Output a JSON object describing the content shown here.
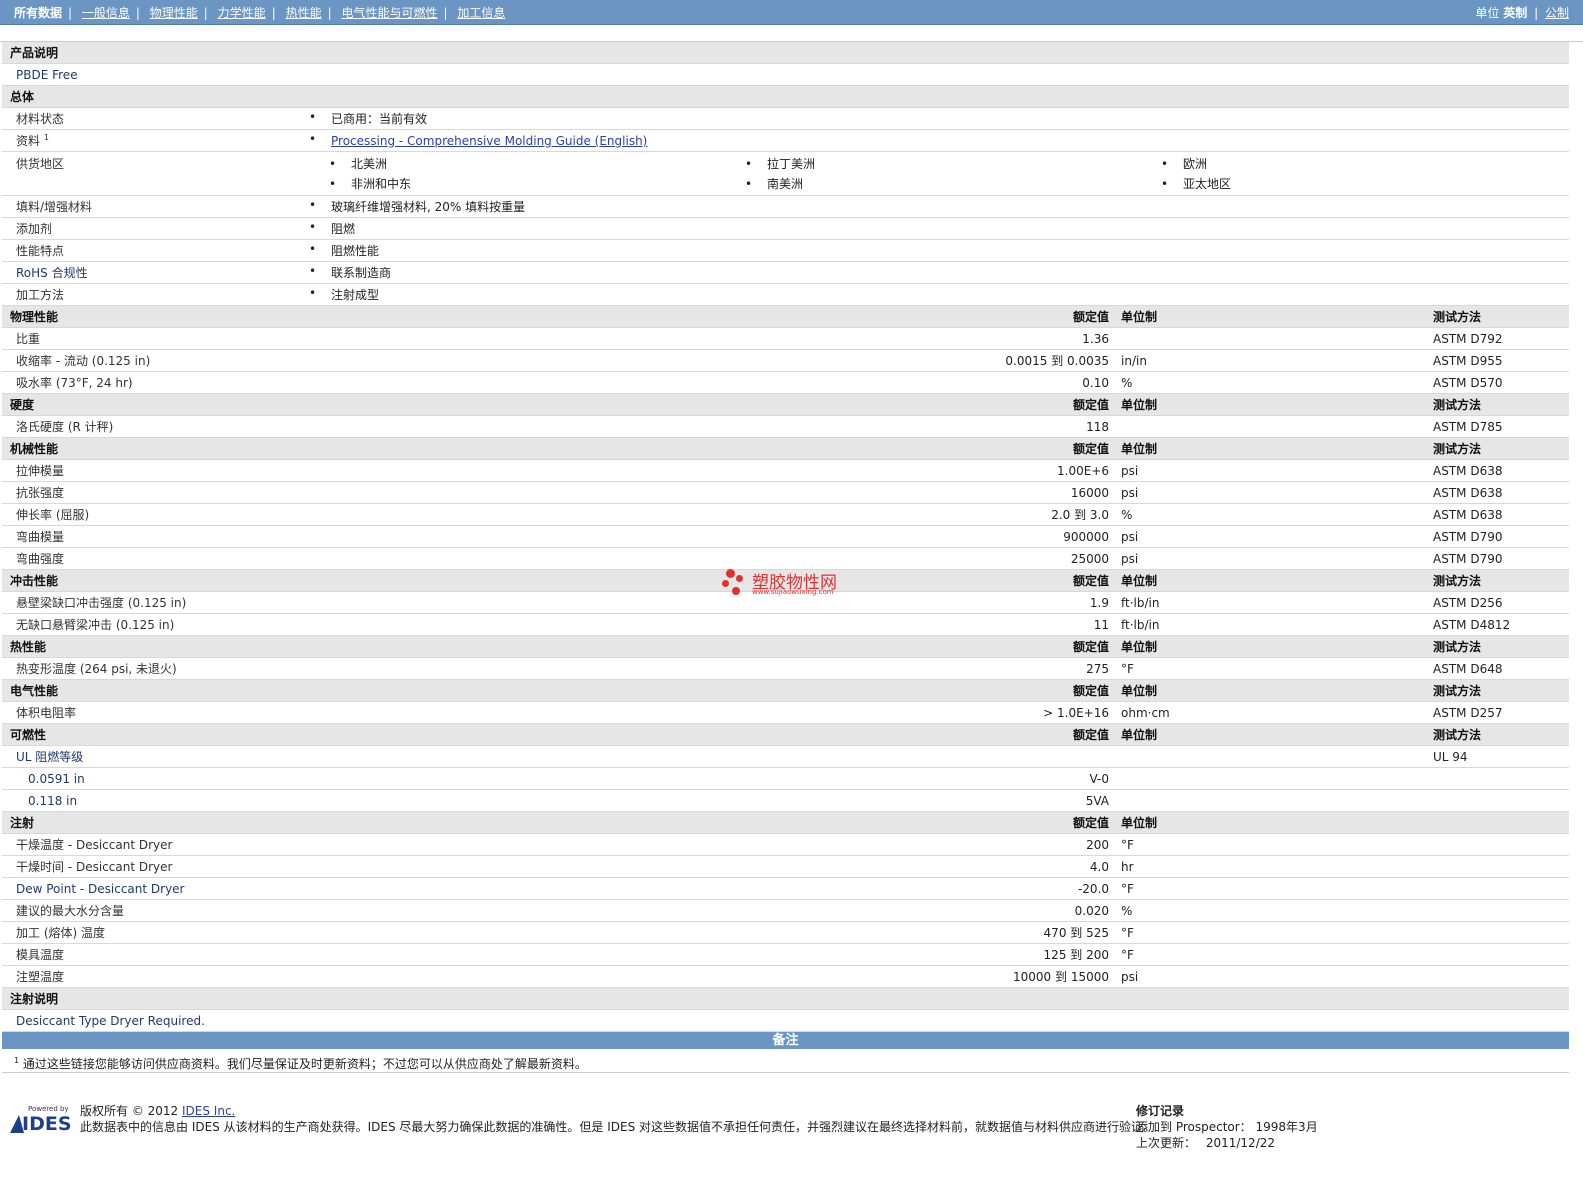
{
  "nav": {
    "tabs": [
      "所有数据",
      "一般信息",
      "物理性能",
      "力学性能",
      "热性能",
      "电气性能与可燃性",
      "加工信息"
    ],
    "unit_label": "单位",
    "unit_english": "英制",
    "unit_metric": "公制"
  },
  "product_desc": {
    "title": "产品说明",
    "text": "PBDE Free"
  },
  "general": {
    "title": "总体",
    "material_status_label": "材料状态",
    "material_status": "已商用：当前有效",
    "docs_label": "资料",
    "docs_sup": "1",
    "docs_link": "Processing - Comprehensive Molding Guide (English)",
    "regions_label": "供货地区",
    "regions": [
      "北美洲",
      "拉丁美洲",
      "欧洲",
      "非洲和中东",
      "南美洲",
      "亚太地区"
    ],
    "filler_label": "填料/增强材料",
    "filler": "玻璃纤维增强材料, 20% 填料按重量",
    "additive_label": "添加剂",
    "additive": "阻燃",
    "features_label": "性能特点",
    "features": "阻燃性能",
    "rohs_label": "RoHS 合规性",
    "rohs": "联系制造商",
    "method_label": "加工方法",
    "method": "注射成型"
  },
  "col": {
    "nominal": "额定值",
    "unit": "单位制",
    "method": "测试方法"
  },
  "sections": [
    {
      "title": "物理性能",
      "rows": [
        {
          "label": "比重",
          "value": "1.36",
          "unit": "",
          "method": "ASTM D792"
        },
        {
          "label": "收缩率 - 流动 (0.125 in)",
          "value": "0.0015 到 0.0035",
          "unit": "in/in",
          "method": "ASTM D955"
        },
        {
          "label": "吸水率 (73°F, 24 hr)",
          "value": "0.10",
          "unit": "%",
          "method": "ASTM D570"
        }
      ]
    },
    {
      "title": "硬度",
      "rows": [
        {
          "label": "洛氏硬度 (R 计秤)",
          "value": "118",
          "unit": "",
          "method": "ASTM D785"
        }
      ]
    },
    {
      "title": "机械性能",
      "rows": [
        {
          "label": "拉伸模量",
          "value": "1.00E+6",
          "unit": "psi",
          "method": "ASTM D638"
        },
        {
          "label": "抗张强度",
          "value": "16000",
          "unit": "psi",
          "method": "ASTM D638"
        },
        {
          "label": "伸长率 (屈服)",
          "value": "2.0 到 3.0",
          "unit": "%",
          "method": "ASTM D638"
        },
        {
          "label": "弯曲模量",
          "value": "900000",
          "unit": "psi",
          "method": "ASTM D790"
        },
        {
          "label": "弯曲强度",
          "value": "25000",
          "unit": "psi",
          "method": "ASTM D790"
        }
      ]
    },
    {
      "title": "冲击性能",
      "rows": [
        {
          "label": "悬壁梁缺口冲击强度 (0.125 in)",
          "value": "1.9",
          "unit": "ft·lb/in",
          "method": "ASTM D256"
        },
        {
          "label": "无缺口悬臂梁冲击 (0.125 in)",
          "value": "11",
          "unit": "ft·lb/in",
          "method": "ASTM D4812"
        }
      ]
    },
    {
      "title": "热性能",
      "rows": [
        {
          "label": "热变形温度 (264 psi, 未退火)",
          "value": "275",
          "unit": "°F",
          "method": "ASTM D648"
        }
      ]
    },
    {
      "title": "电气性能",
      "rows": [
        {
          "label": "体积电阻率",
          "value": "> 1.0E+16",
          "unit": "ohm·cm",
          "method": "ASTM D257"
        }
      ]
    },
    {
      "title": "可燃性",
      "rows": [
        {
          "label": "UL 阻燃等级",
          "value": "",
          "unit": "",
          "method": "UL 94"
        },
        {
          "label": "0.0591 in",
          "value": "V-0",
          "unit": "",
          "method": "",
          "sub": true
        },
        {
          "label": "0.118 in",
          "value": "5VA",
          "unit": "",
          "method": "",
          "sub": true
        }
      ]
    },
    {
      "title": "注射",
      "nomethod": true,
      "rows": [
        {
          "label": "干燥温度 - Desiccant Dryer",
          "value": "200",
          "unit": "°F",
          "method": ""
        },
        {
          "label": "干燥时间 - Desiccant Dryer",
          "value": "4.0",
          "unit": "hr",
          "method": ""
        },
        {
          "label": "Dew Point - Desiccant Dryer",
          "value": "-20.0",
          "unit": "°F",
          "method": ""
        },
        {
          "label": "建议的最大水分含量",
          "value": "0.020",
          "unit": "%",
          "method": ""
        },
        {
          "label": "加工 (熔体) 温度",
          "value": "470 到 525",
          "unit": "°F",
          "method": ""
        },
        {
          "label": "模具温度",
          "value": "125 到 200",
          "unit": "°F",
          "method": ""
        },
        {
          "label": "注塑温度",
          "value": "10000 到 15000",
          "unit": "psi",
          "method": ""
        }
      ]
    }
  ],
  "injection_note": {
    "title": "注射说明",
    "text": "Desiccant Type Dryer Required."
  },
  "notes": {
    "title": "备注",
    "sup": "1",
    "text": "通过这些链接您能够访问供应商资料。我们尽量保证及时更新资料；不过您可以从供应商处了解最新资料。"
  },
  "watermark": {
    "text": "塑胶物性网",
    "url": "www.sujiaowuxing.com"
  },
  "footer": {
    "logo_top": "Powered by",
    "logo_name": "IDES",
    "copyright": "版权所有 © 2012",
    "company": "IDES Inc.",
    "disclaimer": "此数据表中的信息由 IDES 从该材料的生产商处获得。IDES 尽最大努力确保此数据的准确性。但是 IDES 对这些数据值不承担任何责任，并强烈建议在最终选择材料前，就数据值与材料供应商进行验证。",
    "rev_title": "修订记录",
    "added_label": "添加到 Prospector：",
    "added_value": "1998年3月",
    "updated_label": "上次更新：",
    "updated_value": "2011/12/22"
  }
}
